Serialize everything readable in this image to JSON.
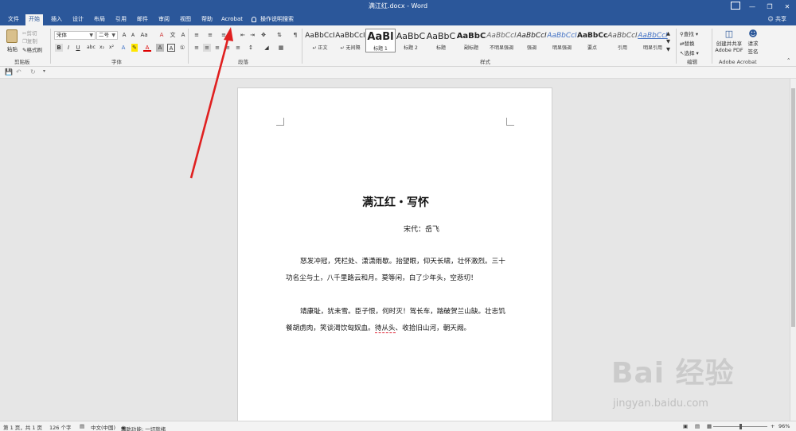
{
  "window": {
    "title": "满江红.docx - Word",
    "controls": [
      "—",
      "❐",
      "✕"
    ],
    "share": "共享"
  },
  "tabs": [
    {
      "label": "文件",
      "active": false
    },
    {
      "label": "开始",
      "active": true
    },
    {
      "label": "插入",
      "active": false
    },
    {
      "label": "设计",
      "active": false
    },
    {
      "label": "布局",
      "active": false
    },
    {
      "label": "引用",
      "active": false
    },
    {
      "label": "邮件",
      "active": false
    },
    {
      "label": "审阅",
      "active": false
    },
    {
      "label": "视图",
      "active": false
    },
    {
      "label": "帮助",
      "active": false
    },
    {
      "label": "Acrobat",
      "active": false
    }
  ],
  "tell_me": "操作说明搜索",
  "ribbon": {
    "clipboard": {
      "paste": "粘贴",
      "cut": "剪切",
      "copy": "复制",
      "format_painter": "格式刷",
      "group_label": "剪贴板"
    },
    "font": {
      "font_name": "宋体",
      "font_size": "二号",
      "group_label": "字体"
    },
    "paragraph": {
      "group_label": "段落"
    },
    "styles": {
      "group_label": "样式",
      "items": [
        {
          "sample": "AaBbCcI",
          "name": "↵ 正文",
          "selected": false
        },
        {
          "sample": "AaBbCcI",
          "name": "↵ 无间隔",
          "selected": false
        },
        {
          "sample": "AaBl",
          "name": "标题 1",
          "selected": true
        },
        {
          "sample": "AaBbC",
          "name": "标题 2",
          "selected": false
        },
        {
          "sample": "AaBbC",
          "name": "标题",
          "selected": false
        },
        {
          "sample": "AaBbC",
          "name": "副标题",
          "selected": false
        },
        {
          "sample": "AaBbCcI",
          "name": "不明显强调",
          "selected": false
        },
        {
          "sample": "AaBbCcI",
          "name": "强调",
          "selected": false
        },
        {
          "sample": "AaBbCcI",
          "name": "明显强调",
          "selected": false
        },
        {
          "sample": "AaBbCcI",
          "name": "要点",
          "selected": false
        },
        {
          "sample": "AaBbCcI",
          "name": "引用",
          "selected": false
        },
        {
          "sample": "AaBbCcI",
          "name": "明显引用",
          "selected": false
        }
      ]
    },
    "editing": {
      "find": "查找",
      "replace": "替换",
      "select": "选择",
      "group_label": "编辑"
    },
    "acrobat": {
      "create_share": "创建并共享",
      "create_share_2": "Adobe PDF",
      "request_sign": "请求",
      "request_sign_2": "签名",
      "group_label": "Adobe Acrobat"
    }
  },
  "document": {
    "title": "满江红・写怀",
    "author": "宋代：岳飞",
    "paragraph_1": "怒发冲冠，凭栏处、潇潇雨歇。抬望眼，仰天长啸，壮怀激烈。三十功名尘与土，八千里路云和月。莫等闲，白了少年头，空悲切！",
    "paragraph_2_a": "靖康耻，犹未雪。臣子恨，何时灭！驾长车，踏破贺兰山缺。壮志饥餐胡虏肉，笑谈渴饮匈奴血。",
    "paragraph_2_err": "待从头",
    "paragraph_2_b": "、收拾旧山河，朝天阙。"
  },
  "status": {
    "page": "第 1 页，共 1 页",
    "words": "126 个字",
    "language": "中文(中国)",
    "accessibility": "辅助功能: 一切就绪",
    "zoom": "96%"
  },
  "watermark": {
    "logo": "Bai 经验",
    "url": "jingyan.baidu.com"
  },
  "colors": {
    "accent": "#2b579a",
    "arrow": "#e02020"
  }
}
